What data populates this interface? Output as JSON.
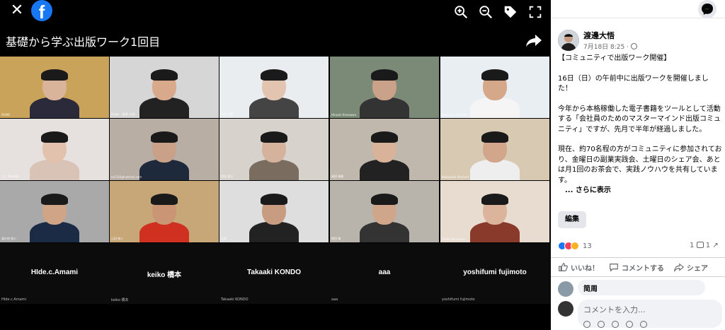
{
  "viewer": {
    "title": "基礎から学ぶ出版ワーク1回目",
    "tiles": [
      {
        "name": "PUMO",
        "bg": "#caa35a",
        "skin": "#d9b49a",
        "shirt": "#2a2a3a"
      },
      {
        "name": "Daigo（渡邊 大悟）",
        "bg": "#d6d6d6",
        "skin": "#d8a98a",
        "shirt": "#222"
      },
      {
        "name": "中村 千穂",
        "bg": "#e9edf0",
        "skin": "#e3c4b0",
        "shirt": "#444"
      },
      {
        "name": "Hiroaki Yonezawa",
        "bg": "#7a8a76",
        "skin": "#caa289",
        "shirt": "#333"
      },
      {
        "name": "Masayuki Nemoto",
        "bg": "#e8eef2",
        "skin": "#d4a888",
        "shirt": "#f5f5f5"
      },
      {
        "name": "ひこ MaruKO",
        "bg": "#e6e1df",
        "skin": "#e2c2ad",
        "shirt": "#d8c3b6"
      },
      {
        "name": "te1310@hotmail.com",
        "bg": "#b8aea4",
        "skin": "#c9a189",
        "shirt": "#1e2a3b"
      },
      {
        "name": "浅見 恵江",
        "bg": "#d8d2cc",
        "skin": "#d5b29c",
        "shirt": "#7a6c5e"
      },
      {
        "name": "岡田 晴美",
        "bg": "#c0b8ad",
        "skin": "#d9b29a",
        "shirt": "#222"
      },
      {
        "name": "Kobayashi Kiminori",
        "bg": "#d8c9b2",
        "skin": "#d2a68a",
        "shirt": "#eee"
      },
      {
        "name": "渡久地 修二",
        "bg": "#a9a9a9",
        "skin": "#d0a486",
        "shirt": "#1b2b45"
      },
      {
        "name": "山田 純人",
        "bg": "#c7a678",
        "skin": "#c99575",
        "shirt": "#d03020"
      },
      {
        "name": "石原",
        "bg": "#dedede",
        "skin": "#c89c80",
        "shirt": "#222"
      },
      {
        "name": "植田 晴",
        "bg": "#b9b4ab",
        "skin": "#d0a68b",
        "shirt": "#333"
      },
      {
        "name": "Yukiko Morisawa",
        "bg": "#e7dccf",
        "skin": "#dcb49c",
        "shirt": "#8a3a2a"
      }
    ],
    "bottom_names": [
      "HIde.c.Amami",
      "keiko 橋本",
      "Takaaki KONDO",
      "aaa",
      "yoshifumi fujimoto"
    ],
    "bottom_small": [
      "HIde.c.Amami",
      "keiko 橋本",
      "Takaaki KONDO",
      "aaa",
      "yoshifumi fujimoto"
    ],
    "icons": {
      "close": "close-icon",
      "zoom_in": "zoom-in-icon",
      "zoom_out": "zoom-out-icon",
      "tag": "tag-icon",
      "fullscreen": "fullscreen-icon",
      "share": "share-arrow-icon"
    }
  },
  "post": {
    "author": "渡邊大悟",
    "date": "7月18日 8:25 ·",
    "paragraphs": [
      "【コミュニティで出版ワーク開催】",
      "16日（日）の午前中に出版ワークを開催しました！",
      "今年から本格稼働した電子書籍をツールとして活動する「会社員のためのマスターマインド出版コミュニティ」ですが、先月で半年が経過しました。",
      "現在、約70名程の方がコミュニティに参加されており、金曜日の副業実践会、土曜日のシェア会、あとは月1回のお茶会で、実践ノウハウを共有しています。"
    ],
    "see_more": "... さらに表示",
    "edit_label": "編集",
    "reaction_count": "13",
    "comment_count": "1",
    "actions": {
      "like": "いいね！",
      "comment": "コメントする",
      "share": "シェア"
    },
    "comment_preview_name": "简周",
    "comment_placeholder": "コメントを入力..."
  },
  "colors": {
    "facebook_blue": "#1877f2",
    "like_blue": "#1877f2",
    "love_red": "#f33e58",
    "haha_yellow": "#f7b125"
  }
}
